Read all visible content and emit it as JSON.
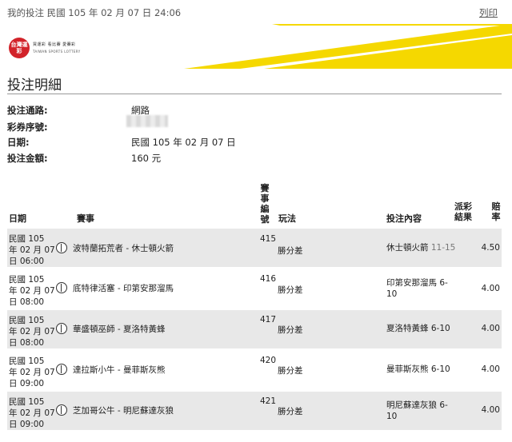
{
  "header": {
    "title": "我的投注  民國 105 年 02 月 07 日 24:06",
    "print_label": "列印"
  },
  "brand": {
    "logo_text": "台灣運彩",
    "tagline": "買運彩 看比賽 愛賽彩",
    "sub": "TAIWAN SPORTS LOTTERY",
    "accent_color": "#f5d800",
    "logo_color": "#d2232a"
  },
  "section_title": "投注明細",
  "info": [
    {
      "label": "投注通路:",
      "value": "網路"
    },
    {
      "label": "彩券序號:",
      "value": ""
    },
    {
      "label": "日期:",
      "value": "民國 105 年 02 月 07 日"
    },
    {
      "label": "投注金額:",
      "value": "160 元"
    }
  ],
  "table": {
    "headers": {
      "date": "日期",
      "event": "賽事",
      "num": "賽事編號",
      "play": "玩法",
      "pick": "投注內容",
      "result": "派彩結果",
      "odds": "賠率"
    },
    "rows": [
      {
        "date": "民國 105 年 02 月 07 日 06:00",
        "event": "波特蘭拓荒者 - 休士頓火箭",
        "num": "415",
        "play": "勝分差",
        "pick": "休士頓火箭",
        "score": "11-15",
        "odds": "4.50"
      },
      {
        "date": "民國 105 年 02 月 07 日 08:00",
        "event": "底特律活塞 - 印第安那溜馬",
        "num": "416",
        "play": "勝分差",
        "pick": "印第安那溜馬",
        "score": "6-10",
        "odds": "4.00"
      },
      {
        "date": "民國 105 年 02 月 07 日 08:00",
        "event": "華盛頓巫師 - 夏洛特黃蜂",
        "num": "417",
        "play": "勝分差",
        "pick": "夏洛特黃蜂",
        "score": "6-10",
        "odds": "4.00"
      },
      {
        "date": "民國 105 年 02 月 07 日 09:00",
        "event": "達拉斯小牛 - 曼菲斯灰熊",
        "num": "420",
        "play": "勝分差",
        "pick": "曼菲斯灰熊",
        "score": "6-10",
        "odds": "4.00"
      },
      {
        "date": "民國 105 年 02 月 07 日 09:00",
        "event": "芝加哥公牛 - 明尼蘇達灰狼",
        "num": "421",
        "play": "勝分差",
        "pick": "明尼蘇達灰狼",
        "score": "6-10",
        "odds": "4.00"
      }
    ]
  }
}
